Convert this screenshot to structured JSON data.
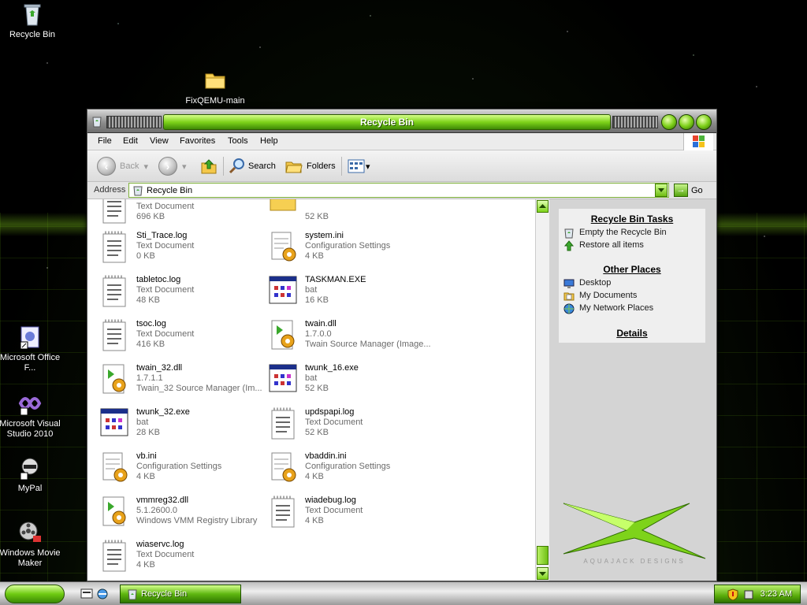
{
  "desktop": {
    "icons": [
      {
        "label": "Recycle Bin"
      },
      {
        "label": "FixQEMU-main"
      },
      {
        "label": "Microsoft Office F..."
      },
      {
        "label": "Microsoft Visual Studio 2010"
      },
      {
        "label": "MyPal"
      },
      {
        "label": "Windows Movie Maker"
      }
    ]
  },
  "window": {
    "title": "Recycle Bin",
    "menu": [
      "File",
      "Edit",
      "View",
      "Favorites",
      "Tools",
      "Help"
    ],
    "toolbar": {
      "back_label": "Back",
      "search_label": "Search",
      "folders_label": "Folders"
    },
    "address": {
      "label": "Address",
      "value": "Recycle Bin",
      "go_label": "Go"
    },
    "files": [
      {
        "name": "",
        "type": "Text Document",
        "size": "696 KB",
        "icon": "text-document-icon"
      },
      {
        "name": "",
        "type": "",
        "size": "52 KB",
        "icon": "folder-icon"
      },
      {
        "name": "Sti_Trace.log",
        "type": "Text Document",
        "size": "0 KB",
        "icon": "text-document-icon"
      },
      {
        "name": "system.ini",
        "type": "Configuration Settings",
        "size": "4 KB",
        "icon": "config-settings-icon"
      },
      {
        "name": "tabletoc.log",
        "type": "Text Document",
        "size": "48 KB",
        "icon": "text-document-icon"
      },
      {
        "name": "TASKMAN.EXE",
        "type": "bat",
        "size": "16 KB",
        "icon": "executable-icon"
      },
      {
        "name": "tsoc.log",
        "type": "Text Document",
        "size": "416 KB",
        "icon": "text-document-icon"
      },
      {
        "name": "twain.dll",
        "type": "1.7.0.0",
        "size": "Twain Source Manager (Image...",
        "icon": "dll-icon"
      },
      {
        "name": "twain_32.dll",
        "type": "1.7.1.1",
        "size": "Twain_32 Source Manager (Im...",
        "icon": "dll-icon"
      },
      {
        "name": "twunk_16.exe",
        "type": "bat",
        "size": "52 KB",
        "icon": "executable-icon"
      },
      {
        "name": "twunk_32.exe",
        "type": "bat",
        "size": "28 KB",
        "icon": "executable-icon"
      },
      {
        "name": "updspapi.log",
        "type": "Text Document",
        "size": "52 KB",
        "icon": "text-document-icon"
      },
      {
        "name": "vb.ini",
        "type": "Configuration Settings",
        "size": "4 KB",
        "icon": "config-settings-icon"
      },
      {
        "name": "vbaddin.ini",
        "type": "Configuration Settings",
        "size": "4 KB",
        "icon": "config-settings-icon"
      },
      {
        "name": "vmmreg32.dll",
        "type": "5.1.2600.0",
        "size": "Windows VMM Registry Library",
        "icon": "dll-icon"
      },
      {
        "name": "wiadebug.log",
        "type": "Text Document",
        "size": "4 KB",
        "icon": "text-document-icon"
      },
      {
        "name": "wiaservc.log",
        "type": "Text Document",
        "size": "4 KB",
        "icon": "text-document-icon"
      }
    ],
    "taskpane": {
      "tasks_heading": "Recycle Bin Tasks",
      "tasks": [
        "Empty the Recycle Bin",
        "Restore all items"
      ],
      "places_heading": "Other Places",
      "places": [
        "Desktop",
        "My Documents",
        "My Network Places"
      ],
      "details_heading": "Details",
      "brand": "AQUAJACK DESIGNS"
    }
  },
  "taskbar": {
    "task_label": "Recycle Bin",
    "clock": "3:23 AM"
  },
  "colors": {
    "accent_green": "#7ed31a",
    "dark_green": "#2f6a00"
  }
}
